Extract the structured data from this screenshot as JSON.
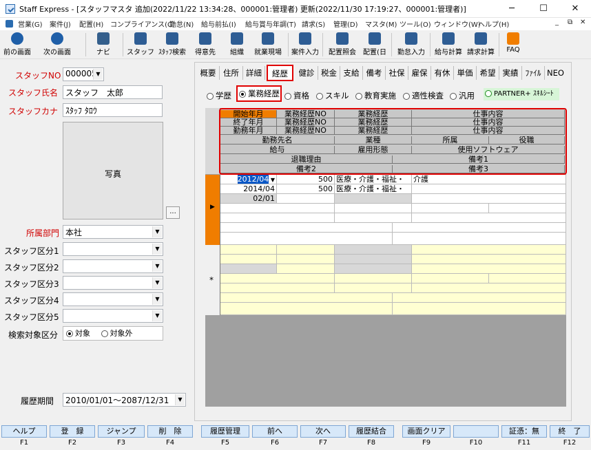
{
  "window": {
    "title": "Staff Express - [スタッフマスタ 追加(2022/11/22 13:34:28、000001:管理者) 更新(2022/11/30 17:19:27、000001:管理者)]",
    "min": "─",
    "max": "☐",
    "close": "✕"
  },
  "menu": [
    "営業(G)",
    "案件(J)",
    "配置(H)",
    "コンプライアンス(C)",
    "勤怠(N)",
    "給与前払(I)",
    "給与賞与年調(T)",
    "請求(S)",
    "管理(D)",
    "マスタ(M)",
    "ツール(O)",
    "ウィンドウ(W)",
    "ヘルプ(H)"
  ],
  "mdi_controls": [
    "_",
    "⧉",
    "✕"
  ],
  "toolbar": [
    "前の画面",
    "次の画面",
    "ナビ",
    "スタッフ",
    "ｽﾀｯﾌ検索",
    "得意先",
    "組織",
    "就業現場",
    "案件入力",
    "配置照会",
    "配置(日",
    "勤怠入力",
    "給与計算",
    "請求計算",
    "FAQ"
  ],
  "colors": {
    "accent": "#d00000",
    "orange": "#f07d00",
    "tabHighlight": "#e00000",
    "yellow": "#ffffd2"
  },
  "left": {
    "staff_no_label": "スタッフNO",
    "staff_no": "000005",
    "staff_name_label": "スタッフ氏名",
    "staff_name": "スタッフ　太郎",
    "staff_kana_label": "スタッフカナ",
    "staff_kana": "ｽﾀｯﾌ ﾀﾛｳ",
    "photo_label": "写真",
    "photo_btn": "...",
    "dept_label": "所属部門",
    "dept": "本社",
    "kubun": [
      {
        "label": "スタッフ区分1"
      },
      {
        "label": "スタッフ区分2"
      },
      {
        "label": "スタッフ区分3"
      },
      {
        "label": "スタッフ区分4"
      },
      {
        "label": "スタッフ区分5"
      }
    ],
    "search_label": "検索対象区分",
    "search_on": "対象",
    "search_off": "対象外",
    "history_label": "履歴期間",
    "history": "2010/01/01～2087/12/31"
  },
  "tabs": [
    "概要",
    "住所",
    "詳細",
    "経歴",
    "健診",
    "税金",
    "支給",
    "備考",
    "社保",
    "雇保",
    "有休",
    "単価",
    "希望",
    "実績",
    "ﾌｧｲﾙ",
    "NEO"
  ],
  "subtypes": [
    "学歴",
    "業務経歴",
    "資格",
    "スキル",
    "教育実施",
    "適性検査",
    "汎用"
  ],
  "partner": "PARTNER+ ｽｷﾙｼｰﾄ",
  "grid": {
    "headers": {
      "start": "開始年月",
      "end": "終了年月",
      "years": "勤務年月",
      "no": "業務経歴NO",
      "biz": "業務経歴",
      "content": "仕事内容",
      "workplace": "勤務先名",
      "industry": "業種",
      "dept": "所属",
      "position": "役職",
      "salary": "給与",
      "emptype": "雇用形態",
      "software": "使用ソフトウェア",
      "reason": "退職理由",
      "remark1": "備考1",
      "remark2": "備考2",
      "remark3": "備考3"
    },
    "row": {
      "start": "2012/04",
      "end": "2014/04",
      "years": "02/01",
      "no1": "500",
      "no2": "500",
      "biz1": "医療・介護・福祉・",
      "biz2": "医療・介護・福祉・",
      "content1": "介護"
    },
    "new_row_marker": "*"
  },
  "fkeys": [
    {
      "label": "ヘルプ",
      "key": "F1"
    },
    {
      "label": "登　録",
      "key": "F2"
    },
    {
      "label": "ジャンプ",
      "key": "F3"
    },
    {
      "label": "削　除",
      "key": "F4"
    },
    {
      "label": "履歴管理",
      "key": "F5"
    },
    {
      "label": "前へ",
      "key": "F6"
    },
    {
      "label": "次へ",
      "key": "F7"
    },
    {
      "label": "履歴結合",
      "key": "F8"
    },
    {
      "label": "画面クリア",
      "key": "F9"
    },
    {
      "label": "",
      "key": "F10"
    },
    {
      "label": "証憑：無",
      "key": "F11"
    },
    {
      "label": "終　了",
      "key": "F12"
    }
  ]
}
